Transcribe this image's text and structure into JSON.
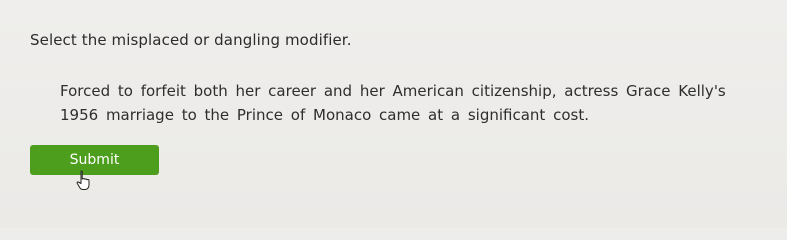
{
  "question": {
    "prompt": "Select the misplaced or dangling modifier."
  },
  "passage": {
    "line1": "Forced to forfeit both her career and her American citizenship, actress Grace Kelly's",
    "line2": "1956 marriage to the Prince of Monaco came at a significant cost."
  },
  "actions": {
    "submit_label": "Submit"
  },
  "colors": {
    "submit_bg": "#4e9e1e",
    "page_bg": "#ededeb"
  },
  "icons": {
    "cursor": "hand-pointer-icon"
  }
}
